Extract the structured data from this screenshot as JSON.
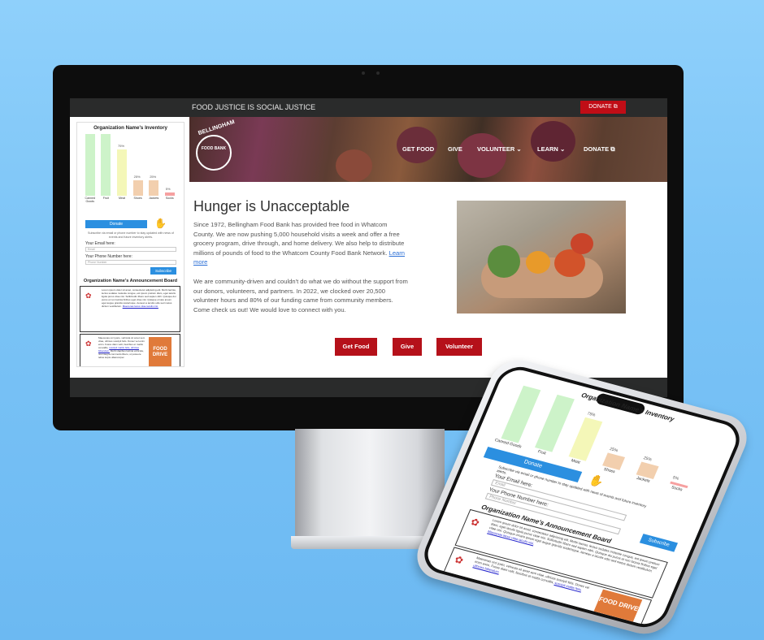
{
  "site": {
    "slogan": "FOOD JUSTICE IS SOCIAL JUSTICE",
    "donate_top": "DONATE",
    "logo_text": "BELLINGHAM",
    "logo_sub": "FOOD BANK",
    "nav": [
      "GET FOOD",
      "GIVE",
      "VOLUNTEER",
      "LEARN",
      "DONATE"
    ],
    "heading": "Hunger is Unacceptable",
    "para1": "Since 1972, Bellingham Food Bank has provided free food in Whatcom County. We are now pushing 5,000 household visits a week and offer a free grocery program, drive through, and home delivery. We also help to distribute millions of pounds of food to the Whatcom County Food Bank Network.",
    "learn_more": "Learn more",
    "para2": "We are community-driven and couldn't do what we do without the support from our donors, volunteers, and partners. In 2022, we clocked over 20,500 volunteer hours and 80% of our funding came from community members. Come check us out! We would love to connect with you.",
    "cta": [
      "Get Food",
      "Give",
      "Volunteer"
    ]
  },
  "widget": {
    "title": "Organization Name's Inventory",
    "bars": [
      {
        "label": "Canned Goods",
        "value": 100,
        "color": "#cdf3c9"
      },
      {
        "label": "Fruit",
        "value": 100,
        "color": "#cdf3c9"
      },
      {
        "label": "Meat",
        "value": 75,
        "color": "#f4f7b8"
      },
      {
        "label": "Shoes",
        "value": 25,
        "color": "#f2cfae"
      },
      {
        "label": "Jackets",
        "value": 25,
        "color": "#f2cfae"
      },
      {
        "label": "Socks",
        "value": 5,
        "color": "#f6a0a0"
      }
    ],
    "pct_labels": [
      "75%",
      "25%",
      "25%",
      "5%"
    ],
    "donate": "Donate",
    "subscribe_note": "Subscribe via email or phone number to stay updated with news of events and future inventory alerts.",
    "email_label": "Your Email here:",
    "email_placeholder": "Email",
    "phone_label": "Your Phone Number here:",
    "phone_placeholder": "Phone Number",
    "subscribe": "Subscribe",
    "announce_title": "Organization Name's Announcement Board",
    "post1": "Lorem ipsum dolor sit amet, consectetur adipiscing elit. Morbi lacinia, lectus sodales molestie congue, est ipsum pretium diam, eget iaculis ligula purus vitae nisi. Sollicitudin libero sed sapien nibh. Quisque dui purus et non lacinia finibus eget vitae nisi. Quisque ornare ipsum eget augue gravida scelerisque. Aenean a iaculis odio sed metus dictum vestibulum.",
    "post1_link": "Maecenas lacus vitae iaculis nisi.",
    "post2": "Maecenas orci justo, vehicula sit amet sem vitae, ultrices suscipit felis. Donec vel enim enim. Fusce diam velit, faucibus et mattis convallis,",
    "post2_link": "suscipit mattis felis, ultricies bibendum.",
    "post2_tail": "Morbi dapibus lacinia vehicula, nisi integra commodo libero, ut posuere tellus turpis ullamcorper.",
    "flyer_text": "FOOD DRIVE"
  },
  "colors": {
    "brand_red": "#b5111a",
    "accent_blue": "#2b8fe0",
    "dark_bar": "#2a2b2b"
  }
}
